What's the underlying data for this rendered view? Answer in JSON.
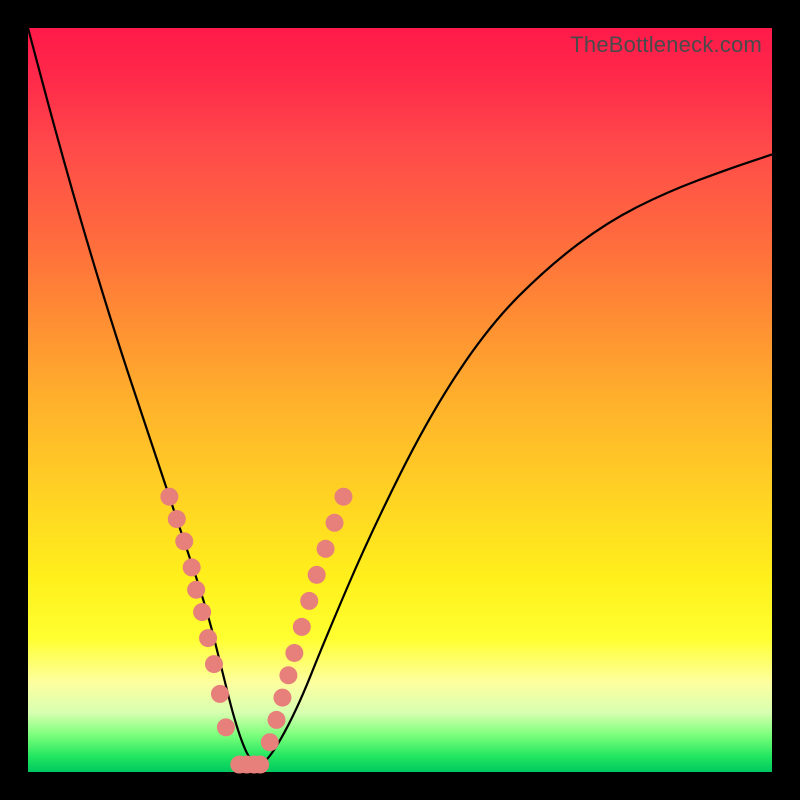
{
  "watermark": "TheBottleneck.com",
  "colors": {
    "marker": "#e77f7b",
    "curve": "#000000",
    "frame": "#000000"
  },
  "chart_data": {
    "type": "line",
    "title": "",
    "xlabel": "",
    "ylabel": "",
    "xlim": [
      0,
      100
    ],
    "ylim": [
      0,
      100
    ],
    "grid": false,
    "series": [
      {
        "name": "bottleneck-curve",
        "x": [
          0,
          4,
          8,
          12,
          16,
          20,
          24,
          26,
          28,
          30,
          32,
          36,
          40,
          46,
          54,
          62,
          70,
          78,
          86,
          94,
          100
        ],
        "y": [
          100,
          85,
          71,
          58,
          46,
          34,
          22,
          14,
          6,
          1,
          1,
          8,
          18,
          32,
          48,
          60,
          68,
          74,
          78,
          81,
          83
        ]
      }
    ],
    "annotations": {
      "left_branch_markers": {
        "x": [
          19,
          20,
          21,
          22,
          22.6,
          23.4,
          24.2,
          25,
          25.8,
          26.6
        ],
        "y": [
          37,
          34,
          31,
          27.5,
          24.5,
          21.5,
          18,
          14.5,
          10.5,
          6
        ]
      },
      "right_branch_markers": {
        "x": [
          32.5,
          33.4,
          34.2,
          35,
          35.8,
          36.8,
          37.8,
          38.8,
          40,
          41.2,
          42.4
        ],
        "y": [
          4,
          7,
          10,
          13,
          16,
          19.5,
          23,
          26.5,
          30,
          33.5,
          37
        ]
      },
      "trough_markers": {
        "x": [
          28.4,
          29.4,
          30.4,
          31.2
        ],
        "y": [
          1,
          1,
          1,
          1
        ]
      }
    }
  }
}
